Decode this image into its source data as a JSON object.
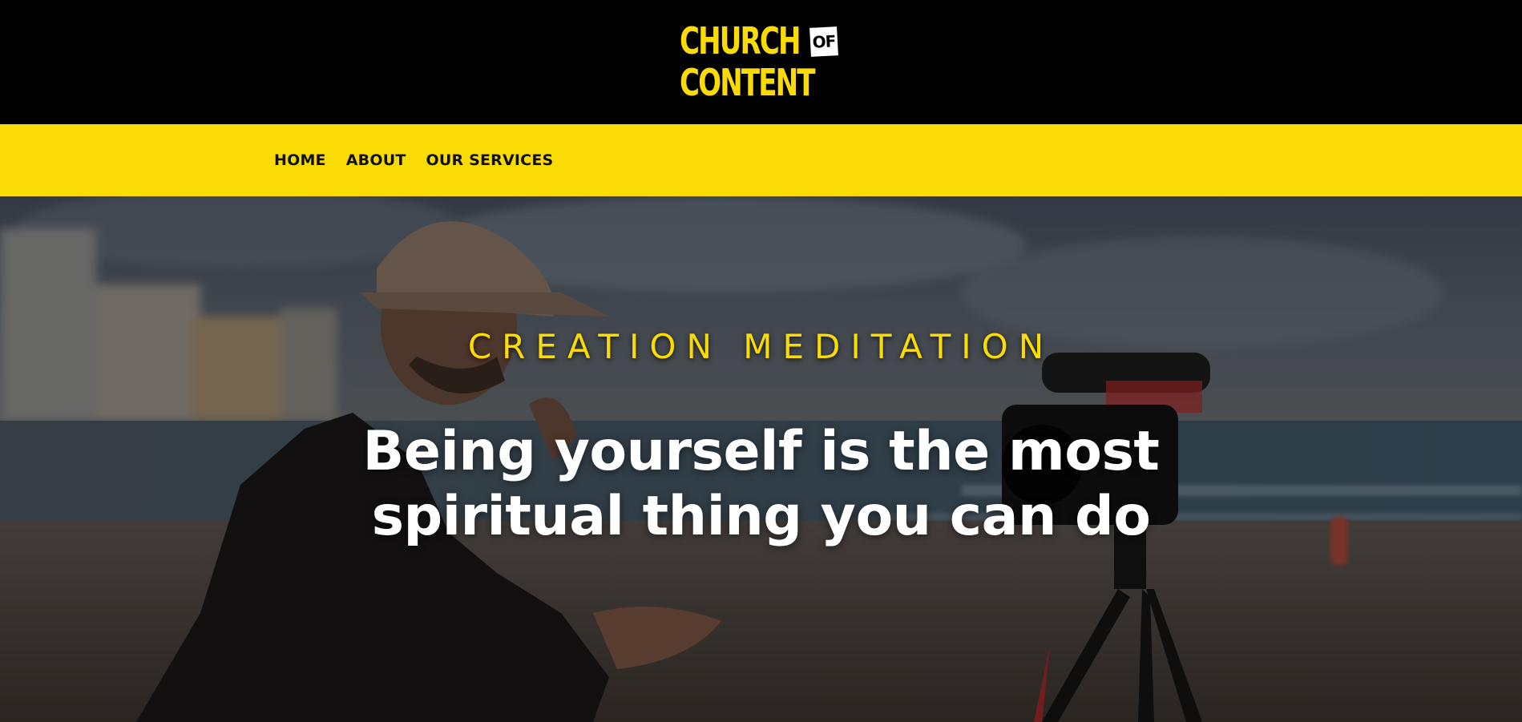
{
  "header": {
    "logo": {
      "line1": "CHURCH",
      "of": "OF",
      "line2": "CONTENT"
    }
  },
  "nav": {
    "items": [
      {
        "label": "HOME"
      },
      {
        "label": "ABOUT"
      },
      {
        "label": "OUR SERVICES"
      }
    ]
  },
  "hero": {
    "eyebrow": "CREATION MEDITATION",
    "headline": "Being yourself is the most spiritual thing you can do",
    "background_image": "man-with-camera-on-beach"
  },
  "colors": {
    "brand_yellow": "#fbdb06",
    "header_black": "#000000",
    "headline_white": "#ffffff"
  }
}
